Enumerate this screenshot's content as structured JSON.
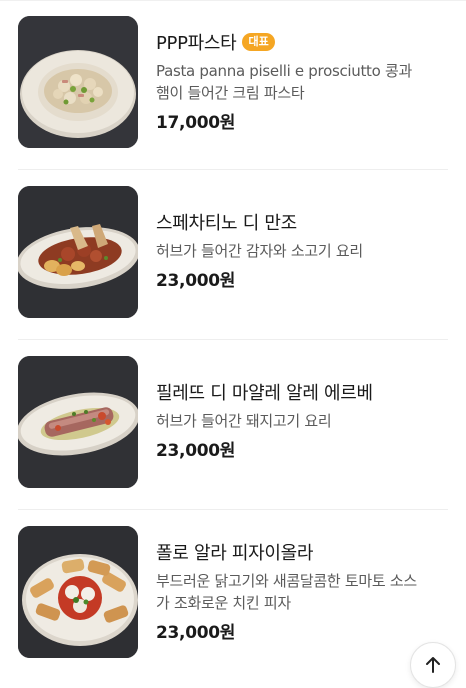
{
  "menu": {
    "items": [
      {
        "name": "PPP파스타",
        "badge": "대표",
        "desc_lines": [
          "Pasta panna piselli e prosciutto 콩과",
          "햄이 들어간 크림 파스타"
        ],
        "price": "17,000원",
        "image_icon": "cream-pasta-dish"
      },
      {
        "name": "스페차티노 디 만조",
        "desc_lines": [
          "허브가 들어간 감자와 소고기 요리"
        ],
        "price": "23,000원",
        "image_icon": "beef-potato-dish"
      },
      {
        "name": "필레뜨 디 마얄레 알레 에르베",
        "desc_lines": [
          "허브가 들어간 돼지고기 요리"
        ],
        "price": "23,000원",
        "image_icon": "herb-pork-dish"
      },
      {
        "name": "폴로 알라 피자이올라",
        "desc_lines": [
          "부드러운 닭고기와 새콤달콤한 토마토 소스",
          "가 조화로운 치킨 피자"
        ],
        "price": "23,000원",
        "image_icon": "chicken-pizzaiola-dish"
      }
    ]
  },
  "scroll_top_icon": "arrow-up-icon",
  "colors": {
    "badge": "#f5a623",
    "text_primary": "#1a1a1a",
    "text_secondary": "#5b5b5b"
  }
}
